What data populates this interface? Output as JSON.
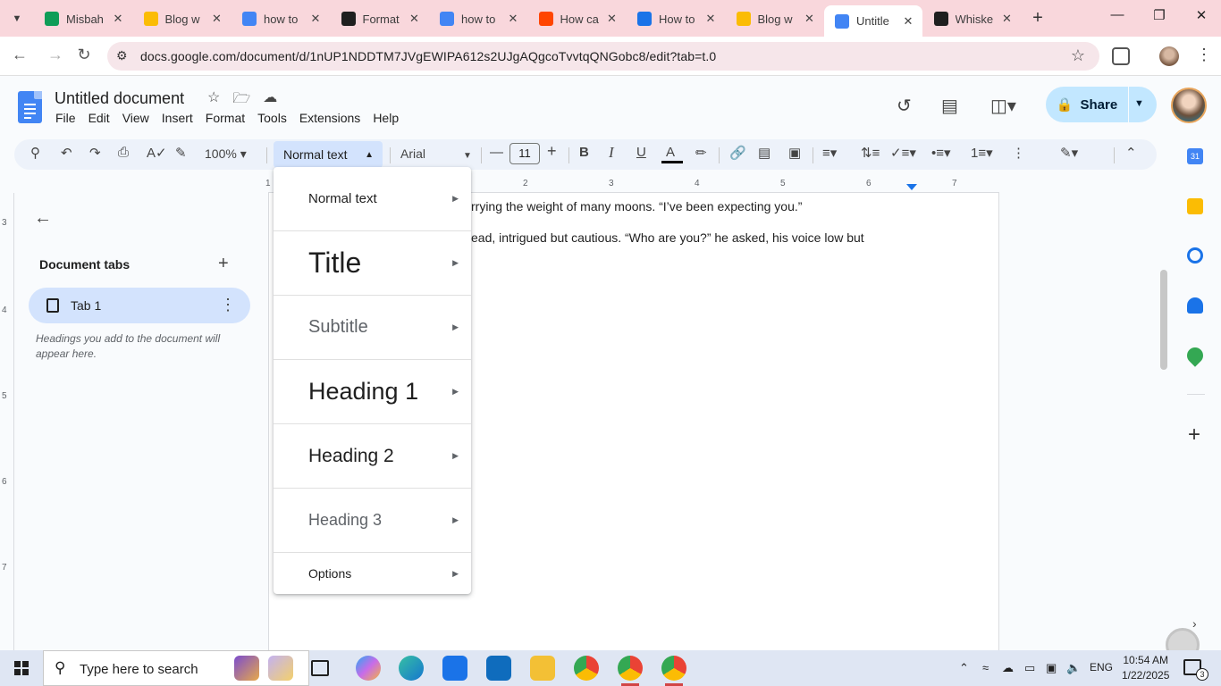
{
  "browser": {
    "tabs": [
      {
        "label": "Misbah",
        "icon": "sheets-icon",
        "color": "#0f9d58",
        "active": false
      },
      {
        "label": "Blog w",
        "icon": "drive-icon",
        "color": "#fbbc04",
        "active": false
      },
      {
        "label": "how to",
        "icon": "docs-icon",
        "color": "#4285f4",
        "active": false
      },
      {
        "label": "Format",
        "icon": "openai-icon",
        "color": "#1f1f1f",
        "active": false
      },
      {
        "label": "how to",
        "icon": "google-icon",
        "color": "#4285f4",
        "active": false
      },
      {
        "label": "How ca",
        "icon": "reddit-icon",
        "color": "#ff4500",
        "active": false
      },
      {
        "label": "How to",
        "icon": "quillbot-icon",
        "color": "#1a73e8",
        "active": false
      },
      {
        "label": "Blog w",
        "icon": "drive-icon",
        "color": "#fbbc04",
        "active": false
      },
      {
        "label": "Untitle",
        "icon": "docs-icon",
        "color": "#4285f4",
        "active": true
      },
      {
        "label": "Whiske",
        "icon": "openai-icon",
        "color": "#1f1f1f",
        "active": false
      }
    ],
    "url": "docs.google.com/document/d/1nUP1NDDTM7JVgEWIPA612s2UJgAQgcoTvvtqQNGobc8/edit?tab=t.0"
  },
  "docs": {
    "title": "Untitled document",
    "menu": [
      "File",
      "Edit",
      "View",
      "Insert",
      "Format",
      "Tools",
      "Extensions",
      "Help"
    ],
    "share_label": "Share",
    "toolbar": {
      "zoom": "100%",
      "style": "Normal text",
      "font": "Arial",
      "font_size": "11"
    },
    "ruler_h": [
      "1",
      "2",
      "3",
      "4",
      "5",
      "6",
      "7"
    ],
    "ruler_v": [
      "3",
      "4",
      "5",
      "6",
      "7"
    ],
    "doc_lines": [
      "rrying the weight of many moons. “I’ve been expecting you.”",
      "ead, intrigued but cautious. “Who are you?” he asked, his voice low but"
    ],
    "side_panel": {
      "title": "Document tabs",
      "tab_label": "Tab 1",
      "hint": "Headings you add to the document will appear here."
    },
    "styles_menu": [
      {
        "label": "Normal text",
        "size": 15
      },
      {
        "label": "Title",
        "size": 32
      },
      {
        "label": "Subtitle",
        "size": 20
      },
      {
        "label": "Heading 1",
        "size": 27
      },
      {
        "label": "Heading 2",
        "size": 21
      },
      {
        "label": "Heading 3",
        "size": 18
      },
      {
        "label": "Options",
        "size": 14
      }
    ]
  },
  "taskbar": {
    "search_placeholder": "Type here to search",
    "lang": "ENG",
    "time": "10:54 AM",
    "date": "1/22/2025",
    "notification_count": "3"
  }
}
